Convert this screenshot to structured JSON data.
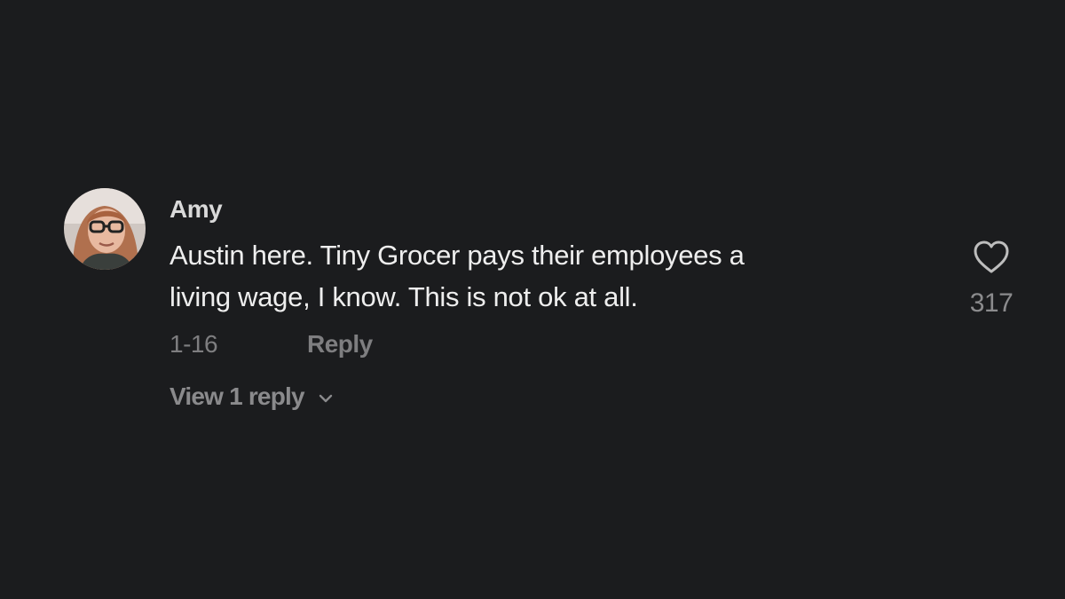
{
  "comment": {
    "author": "Amy",
    "text_line1": "Austin here. Tiny Grocer pays their employees a",
    "text_line2": "living wage, I know. This is not ok at all.",
    "date": "1-16",
    "reply_label": "Reply",
    "view_replies_label": "View 1 reply",
    "like_count": "317",
    "liked": false
  },
  "icons": {
    "like": "heart-icon",
    "expand": "chevron-down-icon",
    "avatar": "avatar-photo"
  },
  "colors": {
    "background": "#1b1c1e",
    "author": "#d9d9d9",
    "text": "#eeeeee",
    "muted": "#7e7e80"
  }
}
